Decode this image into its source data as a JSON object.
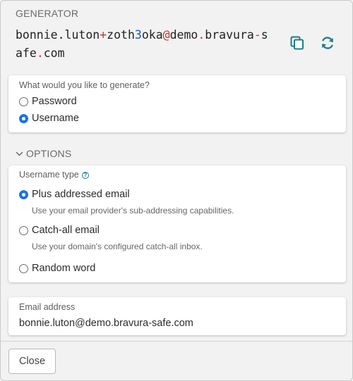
{
  "generator": {
    "heading": "GENERATOR",
    "generated_value": {
      "parts": [
        {
          "text": "bonnie.luton",
          "kind": "plain"
        },
        {
          "text": "+",
          "kind": "special"
        },
        {
          "text": "zoth",
          "kind": "plain"
        },
        {
          "text": "3",
          "kind": "number"
        },
        {
          "text": "oka",
          "kind": "plain"
        },
        {
          "text": "@",
          "kind": "special"
        },
        {
          "text": "demo",
          "kind": "plain"
        },
        {
          "text": ".",
          "kind": "special"
        },
        {
          "text": "bravura",
          "kind": "plain"
        },
        {
          "text": "-",
          "kind": "special"
        },
        {
          "text": "safe",
          "kind": "plain"
        },
        {
          "text": ".",
          "kind": "special"
        },
        {
          "text": "com",
          "kind": "plain"
        }
      ]
    },
    "copy_icon": "copy-icon",
    "regenerate_icon": "refresh-icon"
  },
  "type_card": {
    "question": "What would you like to generate?",
    "options": [
      {
        "label": "Password",
        "checked": false
      },
      {
        "label": "Username",
        "checked": true
      }
    ]
  },
  "options": {
    "heading": "OPTIONS",
    "toggle_icon": "chevron-down-icon",
    "username_type_label": "Username type",
    "help_icon": "help-circle-icon",
    "username_types": [
      {
        "label": "Plus addressed email",
        "hint": "Use your email provider's sub-addressing capabilities.",
        "checked": true
      },
      {
        "label": "Catch-all email",
        "hint": "Use your domain's configured catch-all inbox.",
        "checked": false
      },
      {
        "label": "Random word",
        "hint": "",
        "checked": false
      }
    ]
  },
  "email": {
    "label": "Email address",
    "value": "bonnie.luton@demo.bravura-safe.com"
  },
  "footer": {
    "close_label": "Close"
  },
  "colors": {
    "accent": "#1a73e8",
    "icon_teal": "#1a7f86",
    "special_char": "#c0392b",
    "number_char": "#1a57c7"
  }
}
